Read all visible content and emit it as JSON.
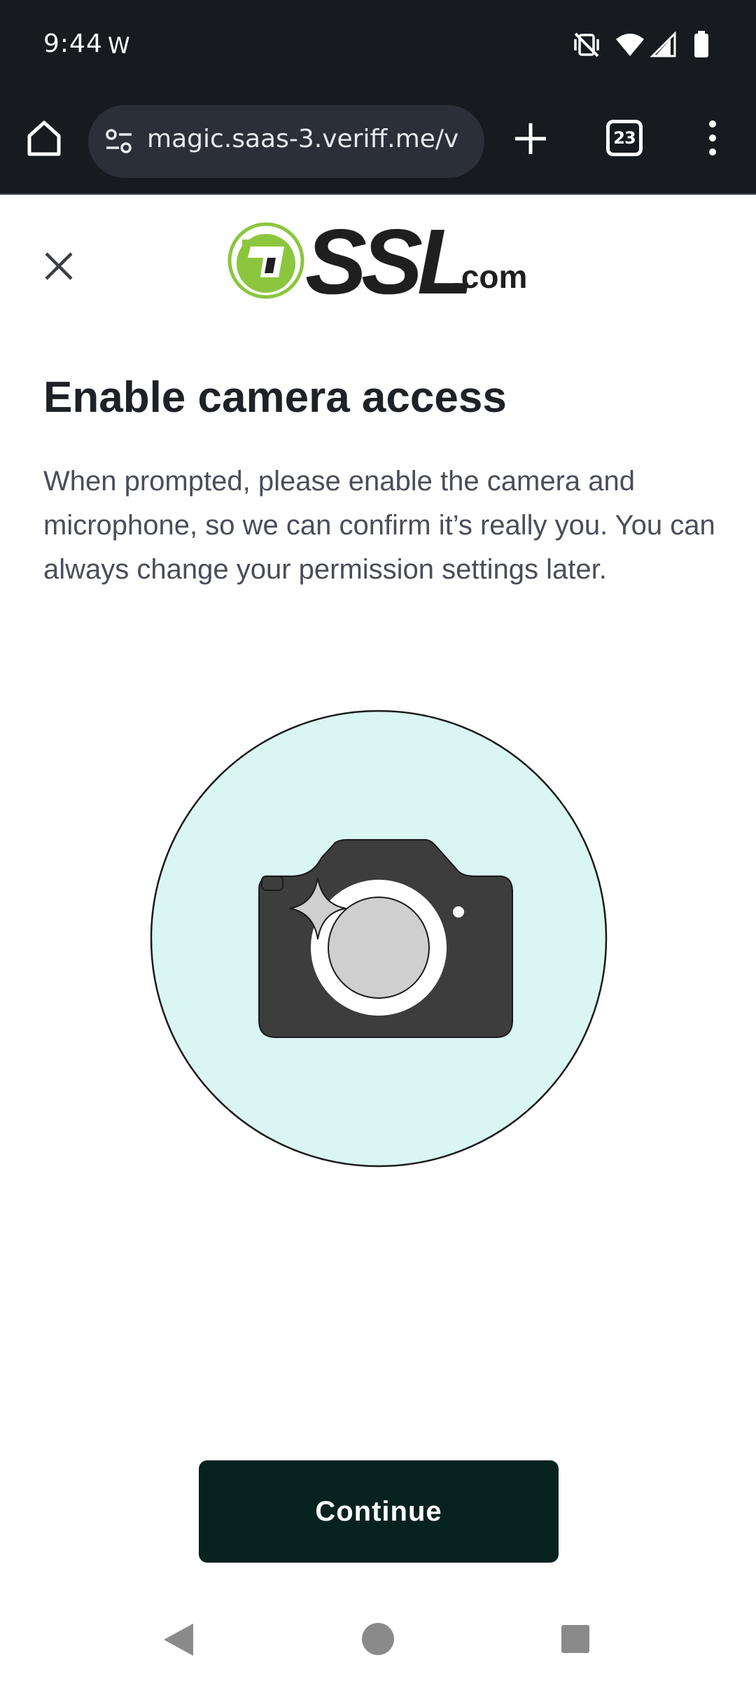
{
  "status_bar": {
    "time": "9:44",
    "notification": "W",
    "icons": [
      "mute-vibrate-icon",
      "wifi-icon",
      "signal-icon",
      "battery-icon"
    ]
  },
  "browser": {
    "url": "magic.saas-3.veriff.me/v",
    "tab_count": "23"
  },
  "header": {
    "logo_text": "SSL",
    "logo_suffix": ".com"
  },
  "content": {
    "title": "Enable camera access",
    "description": "When prompted, please enable the camera and microphone, so we can confirm it’s really you. You can always change your permission settings later."
  },
  "actions": {
    "continue_label": "Continue"
  },
  "colors": {
    "system_bar": "#171a1f",
    "logo_green": "#8cc63f",
    "illustration_bg": "#d9f6f3",
    "camera_body": "#3d3d3d",
    "button_bg": "#06221f"
  }
}
